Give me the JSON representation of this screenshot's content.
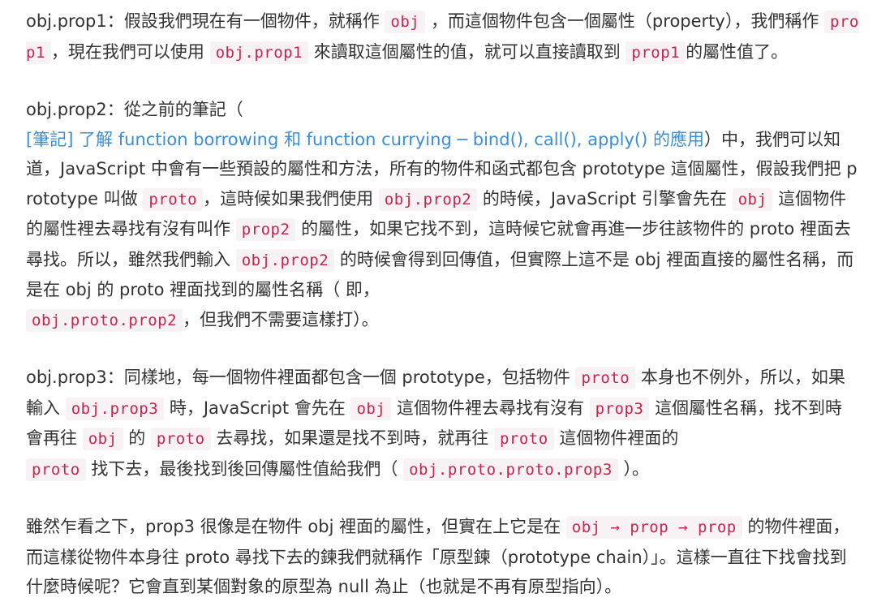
{
  "paragraphs": {
    "p1": {
      "t1": "obj.prop1：假設我們現在有一個物件，就稱作",
      "c1": "obj",
      "t2": "，而這個物件包含一個屬性（property），我們稱作",
      "c2": "prop1",
      "t3": "，現在我們可以使用",
      "c3": "obj.prop1",
      "t4": "來讀取這個屬性的值，就可以直接讀取到",
      "c4": "prop1",
      "t5": "的屬性值了。"
    },
    "p2": {
      "t1": "obj.prop2：從之前的筆記（",
      "link": "[筆記] 了解 function borrowing 和 function currying ─ bind(), call(), apply() 的應用",
      "t2": "）中，我們可以知道，JavaScript 中會有一些預設的屬性和方法，所有的物件和函式都包含 prototype 這個屬性，假設我們把 prototype 叫做",
      "c1": "proto",
      "t3": "，這時候如果我們使用",
      "c2": "obj.prop2",
      "t4": "的時候，JavaScript 引擎會先在",
      "c3": "obj",
      "t5": "這個物件的屬性裡去尋找有沒有叫作",
      "c4": "prop2",
      "t6": "的屬性，如果它找不到，這時候它就會再進一步往該物件的 proto 裡面去尋找。所以，雖然我們輸入",
      "c5": "obj.prop2",
      "t7": "的時候會得到回傳值，但實際上這不是 obj 裡面直接的屬性名稱，而是在 obj 的 proto 裡面找到的屬性名稱（ 即，",
      "c6": "obj.proto.prop2",
      "t8": "，但我們不需要這樣打）。"
    },
    "p3": {
      "t1": "obj.prop3：同樣地，每一個物件裡面都包含一個 prototype，包括物件",
      "c1": "proto",
      "t2": "本身也不例外，所以，如果輸入",
      "c2": "obj.prop3",
      "t3": "時，JavaScript 會先在",
      "c3": "obj",
      "t4": "這個物件裡去尋找有沒有",
      "c4": "prop3",
      "t5": "這個屬性名稱，找不到時會再往",
      "c5": "obj",
      "t6": "的",
      "c6": "proto",
      "t7": "去尋找，如果還是找不到時，就再往",
      "c7": "proto",
      "t8": "這個物件裡面的",
      "c8": "proto",
      "t9": "找下去，最後找到後回傳屬性值給我們（",
      "c9": "obj.proto.proto.prop3",
      "t10": "）。"
    },
    "p4": {
      "t1": "雖然乍看之下，prop3 很像是在物件 obj 裡面的屬性，但實在上它是在",
      "c1": "obj → prop → prop",
      "t2": "的物件裡面，而這樣從物件本身往 proto 尋找下去的鍊我們就稱作「原型鍊（prototype chain）」。這樣一直往下找會找到什麼時候呢？它會直到某個對象的原型為 null 為止（也就是不再有原型指向）。"
    }
  },
  "colors": {
    "text": "#333333",
    "code_text": "#c7254e",
    "code_bg": "#f9f2f4",
    "link": "#3a8ed6"
  }
}
